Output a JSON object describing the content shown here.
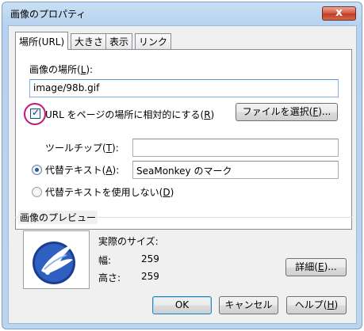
{
  "window": {
    "title": "画像のプロパティ",
    "close_glyph": "x"
  },
  "tabs": [
    {
      "label": "場所(URL)"
    },
    {
      "label": "大きさ"
    },
    {
      "label": "表示"
    },
    {
      "label": "リンク"
    }
  ],
  "location": {
    "label_prefix": "画像の場所(",
    "label_key": "L",
    "label_suffix": "):",
    "value": "image/98b.gif"
  },
  "relative_url": {
    "checked": true,
    "label_prefix": "URL をページの場所に相対的にする(",
    "label_key": "R",
    "label_suffix": ")"
  },
  "choose_file_button": {
    "prefix": "ファイルを選択(",
    "key": "F",
    "suffix": ")..."
  },
  "tooltip": {
    "label_prefix": "ツールチップ(",
    "label_key": "T",
    "label_suffix": "):",
    "value": ""
  },
  "alt_text": {
    "selected": true,
    "label_prefix": "代替テキスト(",
    "label_key": "A",
    "label_suffix": "):",
    "value": "SeaMonkey のマーク"
  },
  "no_alt": {
    "selected": false,
    "label_prefix": "代替テキストを使用しない(",
    "label_key": "D",
    "label_suffix": ")"
  },
  "preview": {
    "group_label": "画像のプレビュー",
    "actual_size_label": "実際のサイズ:",
    "width_label": "幅:",
    "width_value": "259",
    "height_label": "高さ:",
    "height_value": "259"
  },
  "details_button": {
    "prefix": "詳細(",
    "key": "E",
    "suffix": ")..."
  },
  "footer": {
    "ok": "OK",
    "cancel": "キャンセル",
    "help_prefix": "ヘルプ(",
    "help_key": "H",
    "help_suffix": ")"
  },
  "colors": {
    "highlight_ring": "#c0177a",
    "accent": "#1f5ca8"
  }
}
